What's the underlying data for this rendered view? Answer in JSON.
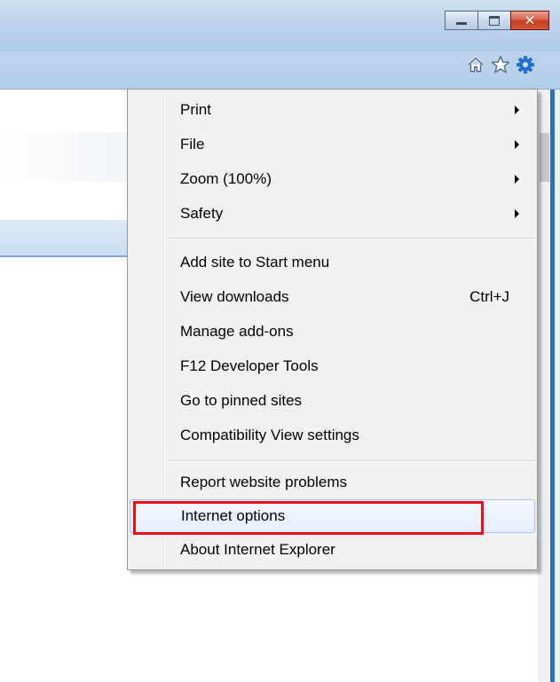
{
  "window": {
    "buttons": {
      "minimize": "minimize",
      "maximize": "maximize",
      "close_glyph": "✕"
    },
    "command_icons": [
      "home-icon",
      "favorites-star-icon",
      "tools-gear-icon"
    ]
  },
  "menu": {
    "items": [
      {
        "label": "Print",
        "submenu": true
      },
      {
        "label": "File",
        "submenu": true
      },
      {
        "label": "Zoom (100%)",
        "submenu": true
      },
      {
        "label": "Safety",
        "submenu": true
      },
      {
        "label": "Add site to Start menu"
      },
      {
        "label": "View downloads",
        "shortcut": "Ctrl+J"
      },
      {
        "label": "Manage add-ons"
      },
      {
        "label": "F12 Developer Tools"
      },
      {
        "label": "Go to pinned sites"
      },
      {
        "label": "Compatibility View settings"
      },
      {
        "label": "Report website problems"
      },
      {
        "label": "Internet options",
        "highlighted": true
      },
      {
        "label": "About Internet Explorer"
      }
    ]
  },
  "colors": {
    "highlight_box": "#e8101a",
    "gear_icon": "#1f6fd1",
    "menu_background": "#f1f1f1"
  }
}
